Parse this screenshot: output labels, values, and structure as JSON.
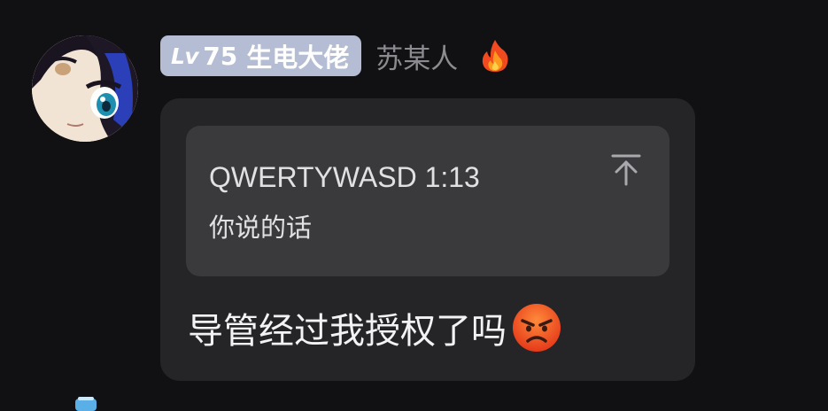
{
  "user": {
    "avatar_icon": "anime-avatar",
    "level_prefix": "Lv",
    "level_number": "75",
    "level_title": "生电大佬",
    "nickname": "苏某人",
    "badge_icon": "fire-icon",
    "badge_color": "#b4bdd4"
  },
  "message": {
    "quote": {
      "author_time": "QWERTYWASD 1:13",
      "text": "你说的话",
      "jump_icon": "scroll-to-top-icon"
    },
    "text": "导管经过我授权了吗",
    "emoji_icon": "angry-face-icon"
  },
  "colors": {
    "background": "#111113",
    "bubble": "#252527",
    "quote_card": "#3a3a3d",
    "nickname": "#8b8b90"
  }
}
